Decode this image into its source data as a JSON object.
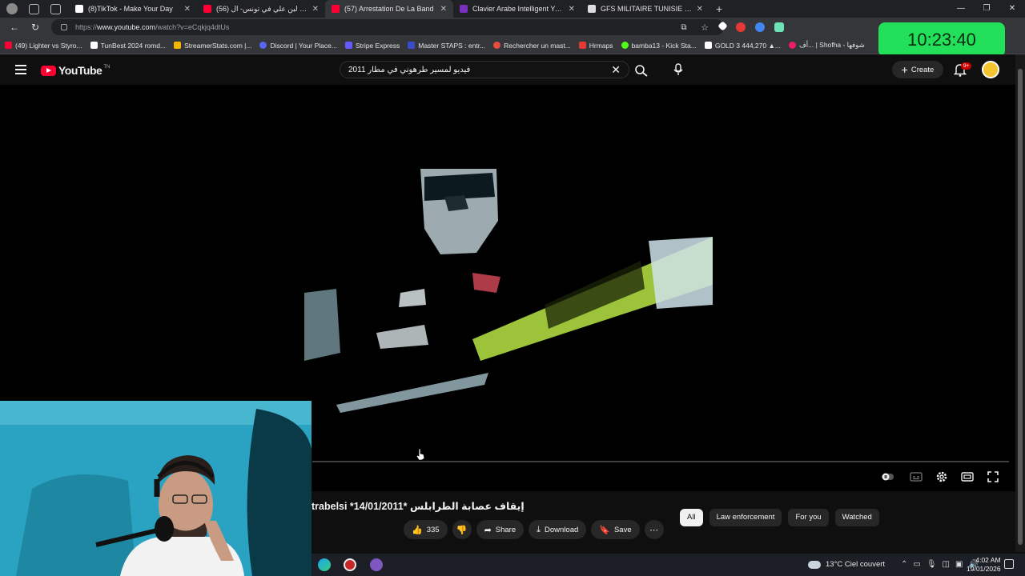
{
  "browser": {
    "tabs": [
      {
        "title": "(8)TikTok - Make Your Day",
        "favicon_color": "#ffffff",
        "active": false
      },
      {
        "title": "(56) اخر يوم لبن علي في تونس- ال",
        "favicon_color": "#ff0033",
        "active": false
      },
      {
        "title": "(57) Arrestation De La Band",
        "favicon_color": "#ff0033",
        "active": true
      },
      {
        "title": "Clavier Arabe Intelligent Yamli™",
        "favicon_color": "#7b2fbe",
        "active": false
      },
      {
        "title": "GFS MILITAIRE TUNISIE - Recherc",
        "favicon_color": "#ffffff",
        "active": false
      }
    ],
    "url_prefix": "https://",
    "url_host": "www.youtube.com",
    "url_path": "/watch?v=eCqkjq4dtUs",
    "bookmarks": [
      {
        "label": "(49) Lighter vs Styro...",
        "color": "#ff0033"
      },
      {
        "label": "TunBest 2024 romd...",
        "color": "#ffffff"
      },
      {
        "label": "StreamerStats.com |...",
        "color": "#f4b400"
      },
      {
        "label": "Discord | Your Place...",
        "color": "#5865f2"
      },
      {
        "label": "Stripe Express",
        "color": "#635bff"
      },
      {
        "label": "Master STAPS : entr...",
        "color": "#3b4cca"
      },
      {
        "label": "Rechercher un mast...",
        "color": "#e74c3c"
      },
      {
        "label": "Hrmaps",
        "color": "#e53935"
      },
      {
        "label": "bamba13 - Kick Sta...",
        "color": "#53fc18"
      },
      {
        "label": "GOLD 3 444,270 ▲...",
        "color": "#ffffff"
      },
      {
        "label": "أف... | Shofha - شوفها",
        "color": "#e91e63"
      }
    ]
  },
  "clock": "10:23:40",
  "youtube": {
    "logo_text": "YouTube",
    "logo_sup": "TN",
    "search_value": "فيديو لمسير طرهوني في مطار 2011",
    "create_label": "Create",
    "notif_badge": "9+",
    "video_title": "trabelsi *14/01/2011* إيقاف عصابة الطرابلس",
    "likes": "335",
    "share_label": "Share",
    "download_label": "Download",
    "save_label": "Save",
    "chips": [
      "All",
      "Law enforcement",
      "For you",
      "Watched"
    ]
  },
  "taskbar": {
    "weather_temp": "13°C",
    "weather_text": "Ciel couvert",
    "time": "4:02 AM",
    "date": "19/01/2026"
  }
}
